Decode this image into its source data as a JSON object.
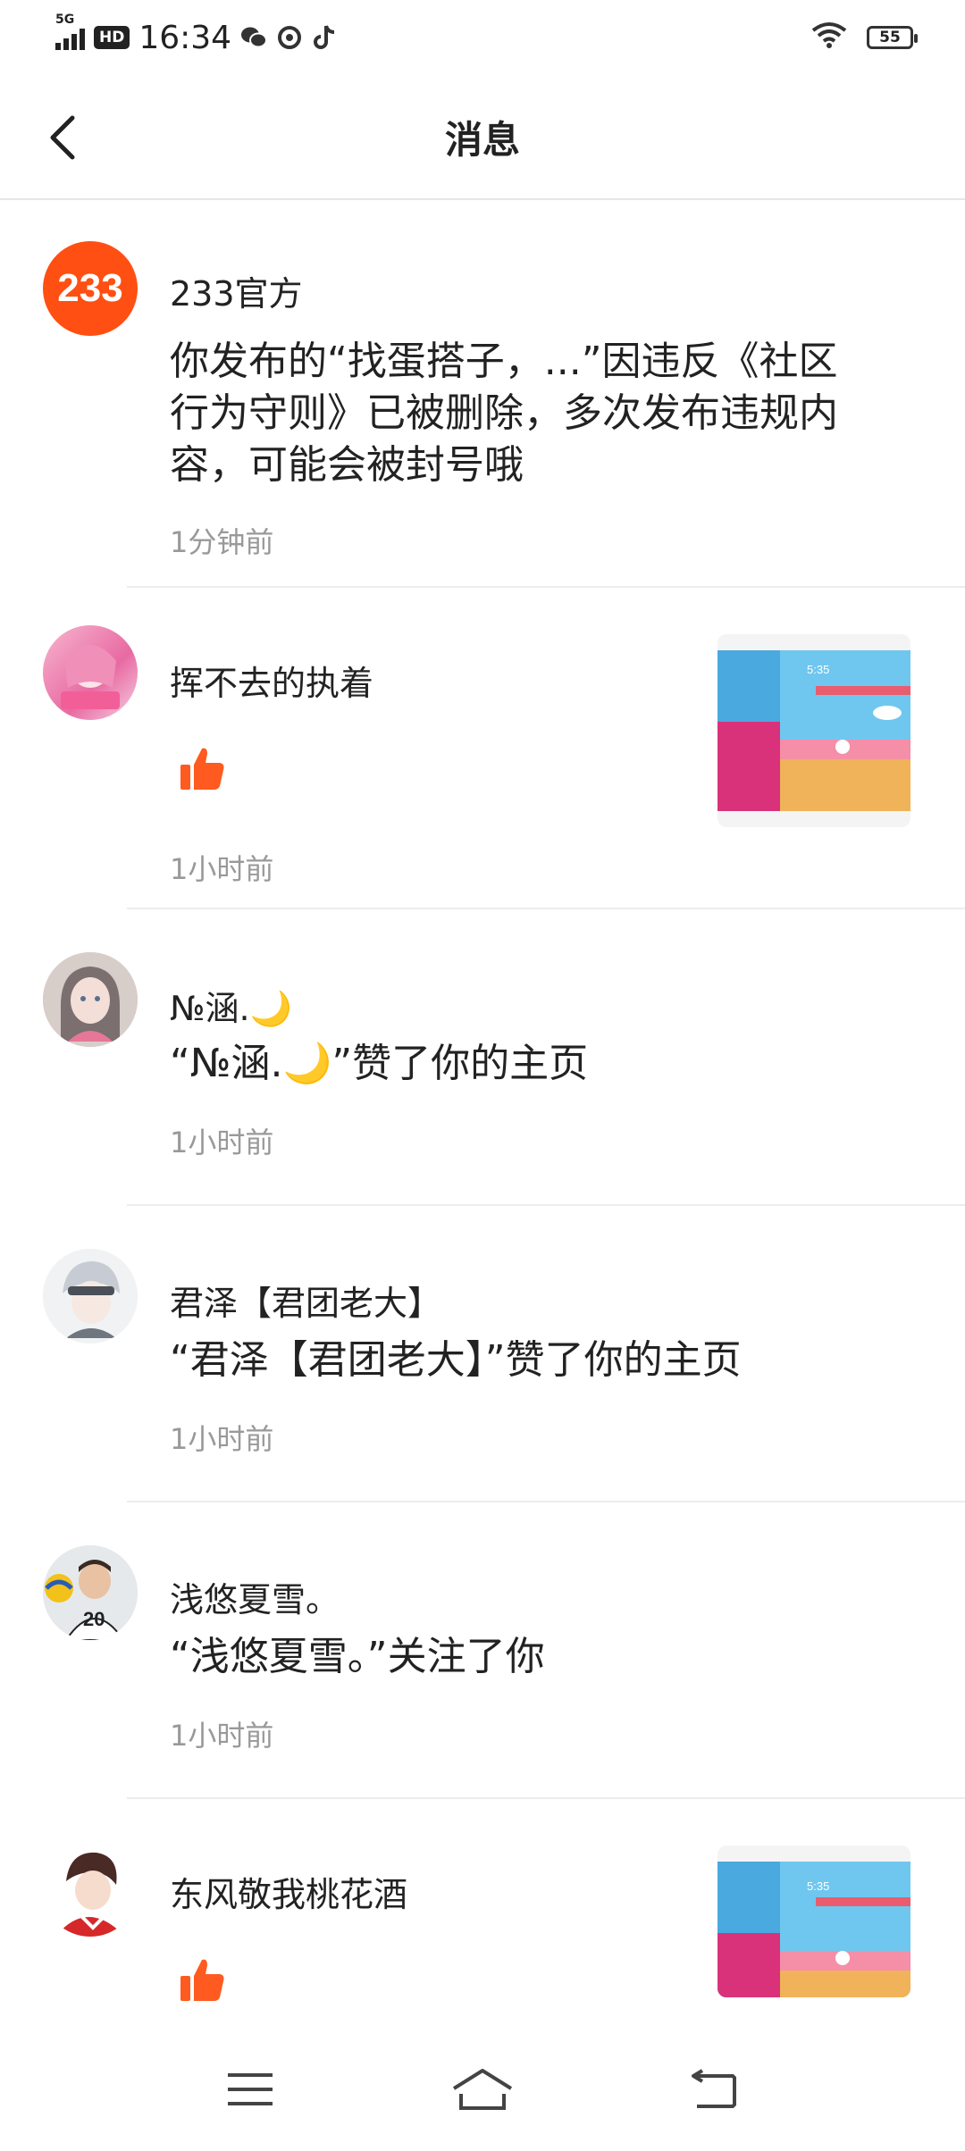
{
  "status_bar": {
    "time": "16:34",
    "network": "5G",
    "hd": "HD",
    "battery": "55"
  },
  "header": {
    "title": "消息"
  },
  "messages": [
    {
      "avatar_text": "233",
      "name": "233官方",
      "content": "你发布的“找蛋搭子，...”因违反《社区行为守则》已被删除，多次发布违规内容，可能会被封号哦",
      "time": "1分钟前"
    },
    {
      "name": "挥不去的执着",
      "like_icon": "thumbs-up-icon",
      "time": "1小时前",
      "thumb_text": "5:35"
    },
    {
      "name": "№涵.🌙",
      "content": "“№涵.🌙”赞了你的主页",
      "time": "1小时前"
    },
    {
      "name": "君泽【君团老大】",
      "content": "“君泽【君团老大】”赞了你的主页",
      "time": "1小时前"
    },
    {
      "avatar_text": "20",
      "name": "浅悠夏雪。",
      "content": "“浅悠夏雪。”关注了你",
      "time": "1小时前"
    },
    {
      "name": "东风敬我桃花酒",
      "like_icon": "thumbs-up-icon",
      "thumb_text": "5:35"
    }
  ],
  "colors": {
    "accent": "#ff5a1f",
    "text": "#222222",
    "muted": "#999999",
    "divider": "#ededed"
  }
}
